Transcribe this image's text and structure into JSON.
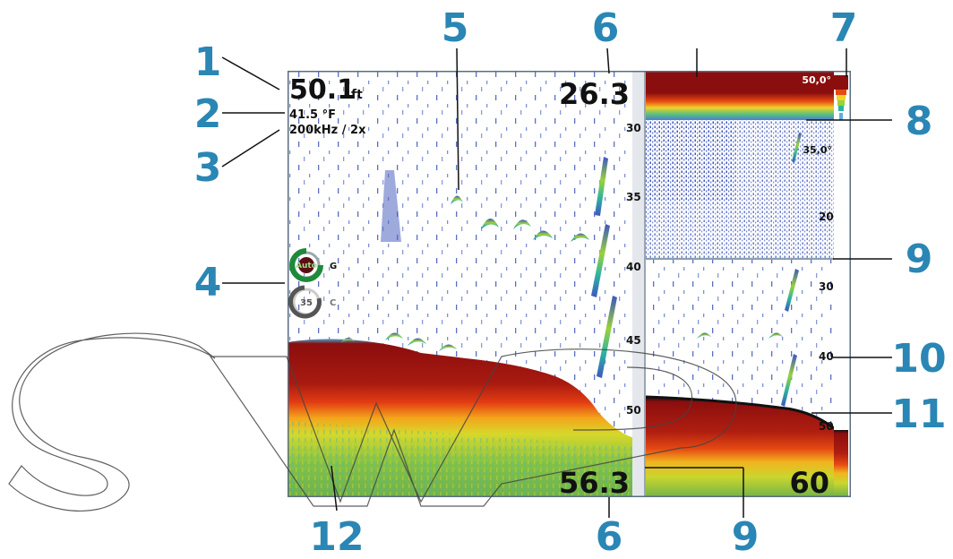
{
  "callouts": [
    "1",
    "2",
    "3",
    "4",
    "5",
    "6",
    "7",
    "8",
    "9",
    "10",
    "11",
    "12",
    "6",
    "9"
  ],
  "depth": {
    "value": "50.1",
    "unit": "ft"
  },
  "water_temp": "41.5 °F",
  "frequency": "200kHz / 2x",
  "gain_knob": {
    "label": "Auto",
    "letter": "G"
  },
  "color_knob": {
    "label": "35",
    "letter": "C"
  },
  "range_top": "26.3",
  "range_bottom": "56.3",
  "zoom_range_bottom": "60",
  "left_scale": [
    "30",
    "35",
    "40",
    "45",
    "50"
  ],
  "right_scale": [
    "20",
    "30",
    "40",
    "50"
  ],
  "temp_labels": [
    "50,0°",
    "35,0°"
  ],
  "colors": {
    "callout": "#2a86b4",
    "bottom": "#8b0e0e",
    "frame": "#5a6e80"
  }
}
